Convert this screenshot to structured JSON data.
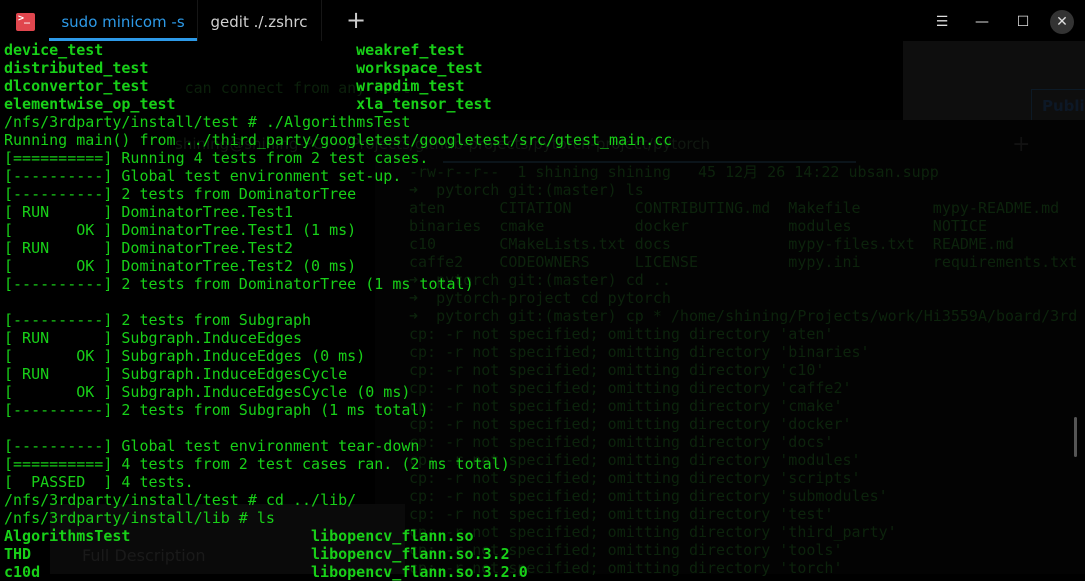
{
  "window": {
    "tabs": [
      {
        "label": "sudo minicom -s",
        "active": true
      },
      {
        "label": "gedit ./.zshrc",
        "active": false
      }
    ],
    "new_tab": "+",
    "app_icon": ">_",
    "controls": {
      "menu": "☰",
      "minimize": "—",
      "maximize": "☐",
      "close": "✕"
    },
    "accent": "#2d9ae8",
    "text_color": "#18d018"
  },
  "terminal": {
    "lines": [
      {
        "a": "device_test",
        "b": "weakref_test",
        "bold": true,
        "col2": 39
      },
      {
        "a": "distributed_test",
        "b": "workspace_test",
        "bold": true,
        "col2": 39
      },
      {
        "a": "dlconvertor_test",
        "b": "wrapdim_test",
        "bold": true,
        "col2": 39
      },
      {
        "a": "elementwise_op_test",
        "b": "xla_tensor_test",
        "bold": true,
        "col2": 39
      },
      {
        "a": "/nfs/3rdparty/install/test # ./AlgorithmsTest"
      },
      {
        "a": "Running main() from ../third_party/googletest/googletest/src/gtest_main.cc"
      },
      {
        "a": "[==========] Running 4 tests from 2 test cases."
      },
      {
        "a": "[----------] Global test environment set-up."
      },
      {
        "a": "[----------] 2 tests from DominatorTree"
      },
      {
        "a": "[ RUN      ] DominatorTree.Test1"
      },
      {
        "a": "[       OK ] DominatorTree.Test1 (1 ms)"
      },
      {
        "a": "[ RUN      ] DominatorTree.Test2"
      },
      {
        "a": "[       OK ] DominatorTree.Test2 (0 ms)"
      },
      {
        "a": "[----------] 2 tests from DominatorTree (1 ms total)"
      },
      {
        "a": ""
      },
      {
        "a": "[----------] 2 tests from Subgraph"
      },
      {
        "a": "[ RUN      ] Subgraph.InduceEdges"
      },
      {
        "a": "[       OK ] Subgraph.InduceEdges (0 ms)"
      },
      {
        "a": "[ RUN      ] Subgraph.InduceEdgesCycle"
      },
      {
        "a": "[       OK ] Subgraph.InduceEdgesCycle (0 ms)"
      },
      {
        "a": "[----------] 2 tests from Subgraph (1 ms total)"
      },
      {
        "a": ""
      },
      {
        "a": "[----------] Global test environment tear-down"
      },
      {
        "a": "[==========] 4 tests from 2 test cases ran. (2 ms total)"
      },
      {
        "a": "[  PASSED  ] 4 tests."
      },
      {
        "a": "/nfs/3rdparty/install/test # cd ../lib/"
      },
      {
        "a": "/nfs/3rdparty/install/lib # ls"
      },
      {
        "a": "AlgorithmsTest",
        "b": "libopencv_flann.so",
        "bold": true,
        "col2": 34
      },
      {
        "a": "THD",
        "b": "libopencv_flann.so.3.2",
        "bold": true,
        "col2": 34
      },
      {
        "a": "c10d",
        "b": "libopencv_flann.so.3.2.0",
        "bold": true,
        "col2": 34
      }
    ]
  },
  "background_window": {
    "title": "shining@shining-PC: ~/Projects/github-projects/pytorch-project/pytorch",
    "hint": "                    can connect from any host",
    "public_button": "Public",
    "full_description": "Full Description",
    "lines": [
      "-rw-r--r--  1 shining shining   45 12月 26 14:22 ubsan.supp",
      "➜  pytorch git:(master) ls",
      "aten      CITATION       CONTRIBUTING.md  Makefile        mypy-README.md",
      "binaries  cmake          docker           modules         NOTICE",
      "c10       CMakeLists.txt docs             mypy-files.txt  README.md",
      "caffe2    CODEOWNERS     LICENSE          mypy.ini        requirements.txt",
      "➜  pytorch git:(master) cd ..",
      "➜  pytorch-project cd pytorch",
      "➜  pytorch git:(master) cp * /home/shining/Projects/work/Hi3559A/board/3rd",
      "cp: -r not specified; omitting directory 'aten'",
      "cp: -r not specified; omitting directory 'binaries'",
      "cp: -r not specified; omitting directory 'c10'",
      "cp: -r not specified; omitting directory 'caffe2'",
      "cp: -r not specified; omitting directory 'cmake'",
      "cp: -r not specified; omitting directory 'docker'",
      "cp: -r not specified; omitting directory 'docs'",
      "cp: -r not specified; omitting directory 'modules'",
      "cp: -r not specified; omitting directory 'scripts'",
      "cp: -r not specified; omitting directory 'submodules'",
      "cp: -r not specified; omitting directory 'test'",
      "cp: -r not specified; omitting directory 'third_party'",
      "cp: -r not specified; omitting directory 'tools'",
      "cp: -r not specified; omitting directory 'torch'"
    ]
  }
}
